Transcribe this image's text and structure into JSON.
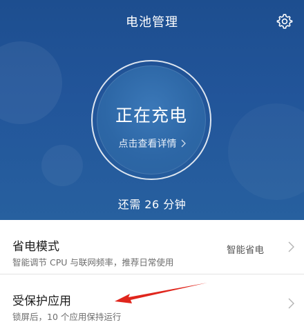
{
  "header": {
    "title": "电池管理",
    "settings_icon": "gear-icon"
  },
  "charge": {
    "status": "正在充电",
    "details_link": "点击查看详情",
    "remaining": "还需 26 分钟"
  },
  "settings_list": [
    {
      "title": "省电模式",
      "subtitle": "智能调节 CPU 与联网频率，推荐日常使用",
      "value": "智能省电"
    },
    {
      "title": "受保护应用",
      "subtitle": "锁屏后，10 个应用保持运行"
    }
  ],
  "colors": {
    "header_bg": "#22559a",
    "annotation": "#e0261d"
  }
}
